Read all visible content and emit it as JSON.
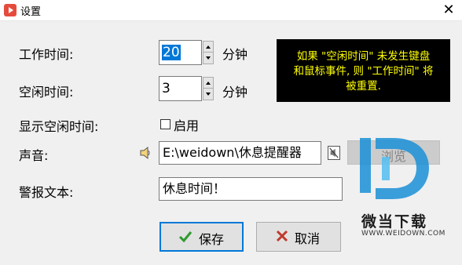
{
  "window": {
    "title": "设置",
    "close_glyph": "✕",
    "icon": "app-icon"
  },
  "work_time": {
    "label": "工作时间:",
    "value": "20",
    "unit": "分钟"
  },
  "idle_time": {
    "label": "空闲时间:",
    "value": "3",
    "unit": "分钟"
  },
  "notice": {
    "lines": [
      "如果 \"空闲时间\" 未发生键盘",
      "和鼠标事件, 则 \"工作时间\" 将",
      "被重置."
    ],
    "text_color": "#ffff00",
    "bg_color": "#000000"
  },
  "show_idle": {
    "label": "显示空闲时间:",
    "checkbox_label": "启用",
    "checked": false
  },
  "sound": {
    "label": "声音:",
    "path": "E:\\weidown\\休息提醒器",
    "browse_label": "浏览",
    "icons": [
      "speaker-icon",
      "mute-icon"
    ]
  },
  "alert_text": {
    "label": "警报文本:",
    "value": "休息时间！"
  },
  "buttons": {
    "save": "保存",
    "cancel": "取消",
    "save_icon": "check-icon",
    "cancel_icon": "x-icon"
  },
  "watermark": {
    "name": "微当下载",
    "url": "WWW.WEIDOWN.COM",
    "logo_color": "#1a8fd6"
  }
}
